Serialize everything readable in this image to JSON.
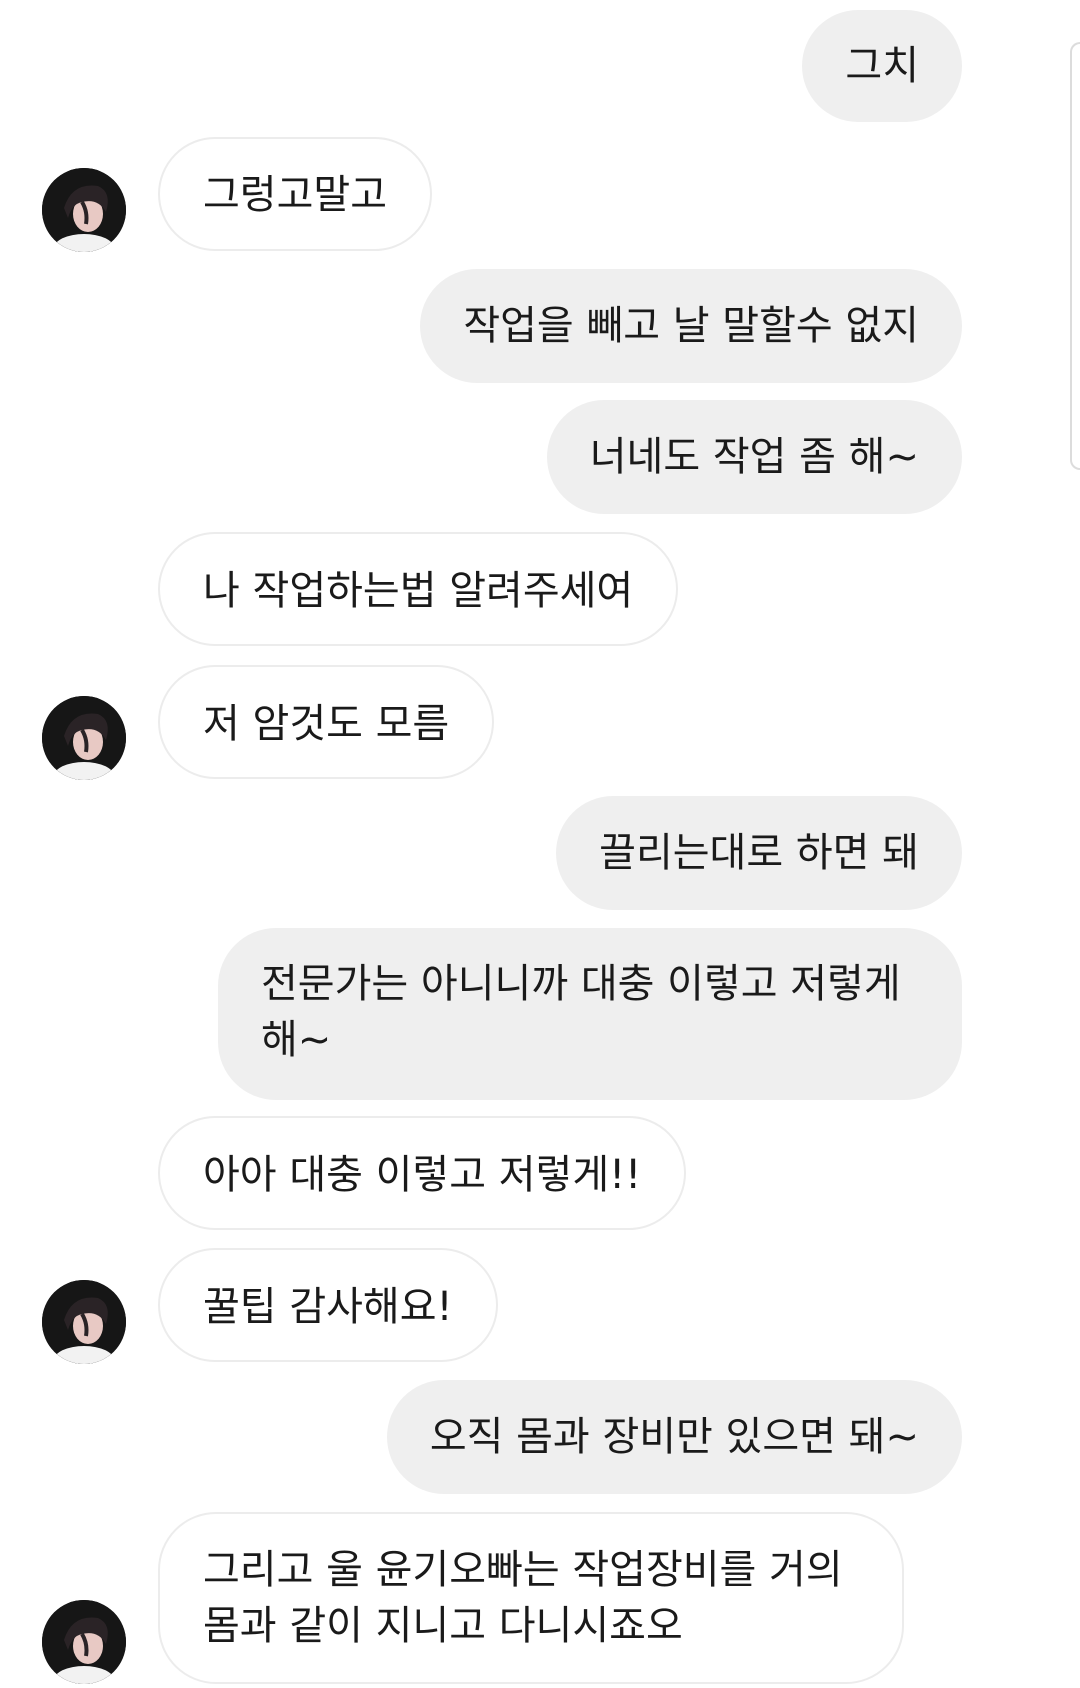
{
  "messages": [
    {
      "id": "m1",
      "side": "sent",
      "text": "그치"
    },
    {
      "id": "m2",
      "side": "received",
      "text": "그렁고말고"
    },
    {
      "id": "m3",
      "side": "sent",
      "text": "작업을 빼고 날 말할수 없지"
    },
    {
      "id": "m4",
      "side": "sent",
      "text": "너네도 작업 좀 해~"
    },
    {
      "id": "m5",
      "side": "received",
      "text": "나 작업하는법 알려주세여"
    },
    {
      "id": "m6",
      "side": "received",
      "text": "저 암것도 모름"
    },
    {
      "id": "m7",
      "side": "sent",
      "text": "끌리는대로 하면 돼"
    },
    {
      "id": "m8",
      "side": "sent",
      "text": "전문가는 아니니까 대충 이렇고 저렇게 해~"
    },
    {
      "id": "m9",
      "side": "received",
      "text": "아아 대충 이렇고 저렇게!!"
    },
    {
      "id": "m10",
      "side": "received",
      "text": "꿀팁 감사해요!"
    },
    {
      "id": "m11",
      "side": "sent",
      "text": "오직 몸과 장비만 있으면 돼~"
    },
    {
      "id": "m12",
      "side": "received",
      "text": "그리고 울 윤기오빠는 작업장비를 거의 몸과 같이 지니고 다니시죠오"
    }
  ],
  "theme": {
    "sent_bubble_color": "#efefef",
    "received_bubble_color": "#ffffff",
    "received_border_color": "#ececec",
    "text_color": "#1a1a1a"
  },
  "avatar_icon": "profile-photo-icon"
}
